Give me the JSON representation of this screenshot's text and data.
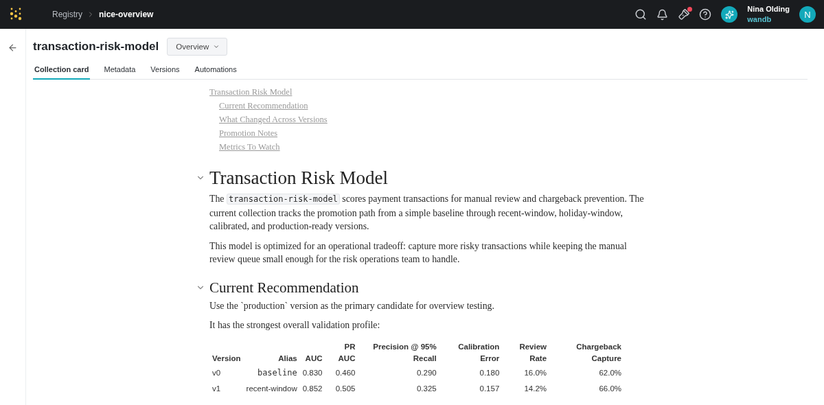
{
  "topbar": {
    "breadcrumb": [
      {
        "label": "Registry",
        "current": false
      },
      {
        "label": "nice-overview",
        "current": true
      }
    ],
    "notification_dot": true,
    "user": {
      "name": "Nina Olding",
      "org": "wandb",
      "initial": "N"
    }
  },
  "header": {
    "title": "transaction-risk-model",
    "view_select": "Overview"
  },
  "tabs": [
    {
      "label": "Collection card",
      "selected": true
    },
    {
      "label": "Metadata",
      "selected": false
    },
    {
      "label": "Versions",
      "selected": false
    },
    {
      "label": "Automations",
      "selected": false
    }
  ],
  "toc": [
    {
      "label": "Transaction Risk Model",
      "children": [
        {
          "label": "Current Recommendation"
        },
        {
          "label": "What Changed Across Versions"
        },
        {
          "label": "Promotion Notes"
        },
        {
          "label": "Metrics To Watch"
        }
      ]
    }
  ],
  "sections": [
    {
      "heading": "Transaction Risk Model",
      "kind": "title",
      "expanded": true,
      "paragraphs": [
        [
          {
            "kind": "text",
            "text": "The "
          },
          {
            "kind": "code",
            "text": "transaction-risk-model"
          },
          {
            "kind": "text",
            "text": " scores payment transactions for manual review and chargeback prevention. The current collection tracks the promotion path from a simple baseline through recent-window, holiday-window, calibrated, and production-ready versions."
          }
        ],
        [
          {
            "kind": "text",
            "text": "This model is optimized for an operational tradeoff: capture more risky transactions while keeping the manual review queue small enough for the risk operations team to handle."
          }
        ]
      ]
    },
    {
      "heading": "Current Recommendation",
      "kind": "section",
      "expanded": true,
      "paragraphs": [
        [
          {
            "kind": "text",
            "text": "Use the `production` version as the primary candidate for overview testing."
          }
        ],
        [
          {
            "kind": "text",
            "text": "It has the strongest overall validation profile:"
          }
        ]
      ],
      "table": {
        "columns": [
          "Version",
          "Alias",
          "AUC",
          "PR AUC",
          "Precision @ 95% Recall",
          "Calibration Error",
          "Review Rate",
          "Chargeback Capture"
        ],
        "rows": [
          [
            {
              "kind": "text",
              "text": "v0"
            },
            {
              "kind": "code",
              "text": "baseline"
            },
            {
              "kind": "text",
              "text": "0.830"
            },
            {
              "kind": "text",
              "text": "0.460"
            },
            {
              "kind": "text",
              "text": "0.290"
            },
            {
              "kind": "text",
              "text": "0.180"
            },
            {
              "kind": "text",
              "text": "16.0%"
            },
            {
              "kind": "text",
              "text": "62.0%"
            }
          ],
          [
            {
              "kind": "text",
              "text": "v1"
            },
            {
              "kind": "text",
              "text": "recent-window"
            },
            {
              "kind": "text",
              "text": "0.852"
            },
            {
              "kind": "text",
              "text": "0.505"
            },
            {
              "kind": "text",
              "text": "0.325"
            },
            {
              "kind": "text",
              "text": "0.157"
            },
            {
              "kind": "text",
              "text": "14.2%"
            },
            {
              "kind": "text",
              "text": "66.0%"
            }
          ]
        ]
      }
    }
  ]
}
